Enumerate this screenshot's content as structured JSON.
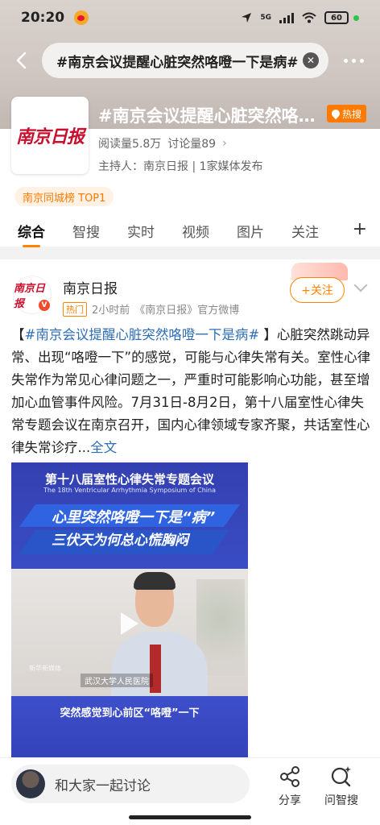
{
  "status_bar": {
    "time": "20:20",
    "network": "5G",
    "battery": "60"
  },
  "search": {
    "query": "#南京会议提醒心脏突然咯噔一下是病#"
  },
  "topic": {
    "logo_text": "南京日报",
    "title": "#南京会议提醒心脏突然咯噔一下是病#",
    "hot_label": "热搜",
    "reads": "阅读量5.8万",
    "discussions": "讨论量89",
    "host": "主持人：南京日报 | 1家媒体发布",
    "rank_chip": "南京同城榜 TOP1"
  },
  "tabs": [
    {
      "label": "综合"
    },
    {
      "label": "智搜"
    },
    {
      "label": "实时"
    },
    {
      "label": "视频"
    },
    {
      "label": "图片"
    },
    {
      "label": "关注"
    }
  ],
  "post": {
    "author": "南京日报",
    "avatar_text": "南京日报",
    "verified_mark": "V",
    "meta_tag": "热门",
    "meta_time": "2小时前",
    "meta_source": "《南京日报》官方微博",
    "follow_label": "+关注",
    "text_open": "【",
    "hashtag": "#南京会议提醒心脏突然咯噔一下是病#",
    "text_body": " 】心脏突然跳动异常、出现“咯噔一下”的感觉，可能与心律失常有关。室性心律失常作为常见心律问题之一，严重时可能影响心功能，甚至增加心血管事件风险。7月31日-8月2日，第十八届室性心律失常专题会议在南京召开，国内心律领域专家齐聚，共话室性心律失常诊疗...",
    "fulltext_label": "全文"
  },
  "video": {
    "title_cn": "第十八届室性心律失常专题会议",
    "title_en": "The 18th Ventricular Arrhythmia Symposium of China",
    "banner_line1": "心里突然咯噔一下是“病”",
    "banner_line2": "三伏天为何总心慌胸闷",
    "hospital_caption": "武汉大学人民医院",
    "watermark": "新华新媒体",
    "subtitle": "突然感觉到心前区“咯噔”一下"
  },
  "bottom": {
    "comment_placeholder": "和大家一起讨论",
    "share_label": "分享",
    "ask_label": "问智搜"
  }
}
